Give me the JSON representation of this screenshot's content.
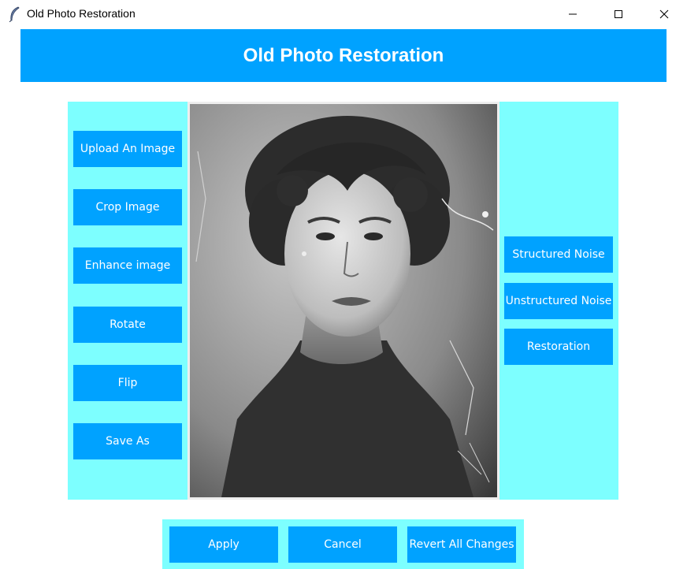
{
  "window": {
    "title": "Old Photo Restoration",
    "icon": "feather-icon",
    "controls": [
      "minimize-icon",
      "maximize-icon",
      "close-icon"
    ]
  },
  "header": {
    "title": "Old Photo Restoration"
  },
  "left_panel": {
    "buttons": [
      {
        "label": "Upload An Image"
      },
      {
        "label": "Crop Image"
      },
      {
        "label": "Enhance image"
      },
      {
        "label": "Rotate"
      },
      {
        "label": "Flip"
      },
      {
        "label": "Save As"
      }
    ]
  },
  "right_panel": {
    "buttons": [
      {
        "label": "Structured Noise"
      },
      {
        "label": "Unstructured Noise"
      },
      {
        "label": "Restoration"
      }
    ]
  },
  "bottom_panel": {
    "buttons": [
      {
        "label": "Apply"
      },
      {
        "label": "Cancel"
      },
      {
        "label": "Revert All Changes"
      }
    ]
  },
  "colors": {
    "accent": "#00a2ff",
    "panel": "#7dffff",
    "button_text": "#ffffff"
  }
}
